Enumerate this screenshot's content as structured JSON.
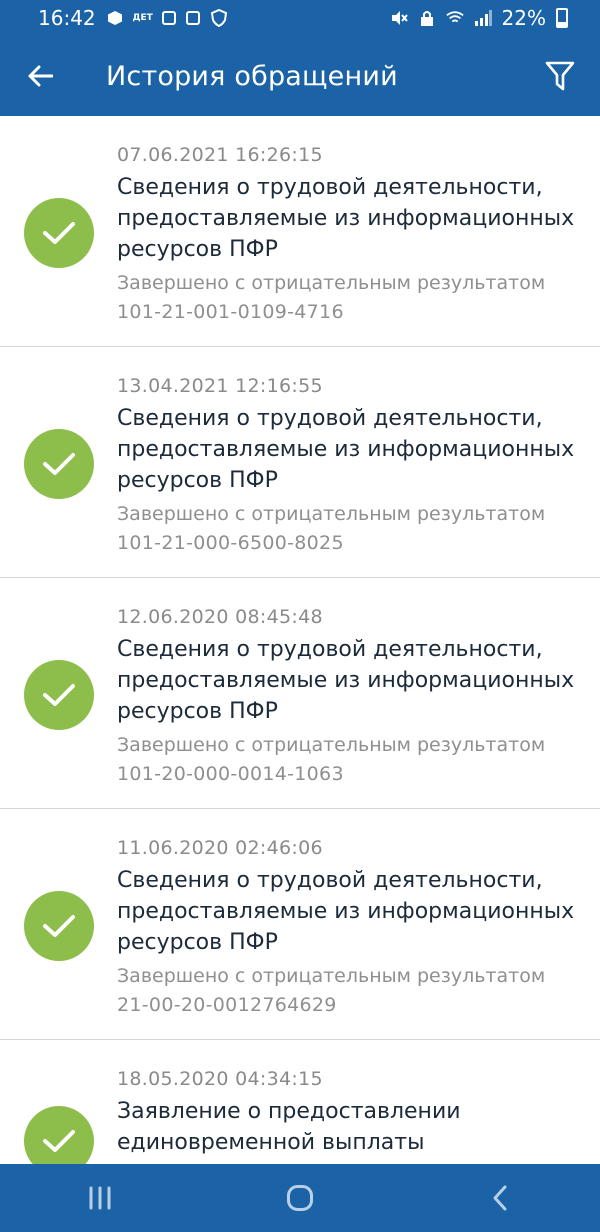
{
  "status_bar": {
    "time": "16:42",
    "battery": "22%",
    "icons": [
      "cube-icon",
      "detmir-icon",
      "qr-icon",
      "camera-icon",
      "shield-icon",
      "mute-icon",
      "lock-icon",
      "wifi-icon",
      "signal-icon",
      "battery-icon"
    ]
  },
  "header": {
    "title": "История обращений",
    "back_icon": "arrow-left-icon",
    "filter_icon": "filter-icon"
  },
  "colors": {
    "primary": "#1b63a6",
    "success": "#8dbd4a"
  },
  "items": [
    {
      "date": "07.06.2021 16:26:15",
      "title": "Сведения о трудовой деятельности, предоставляемые из информационных ресурсов ПФР",
      "status": "Завершено с отрицательным результатом",
      "number": "101-21-001-0109-4716"
    },
    {
      "date": "13.04.2021 12:16:55",
      "title": "Сведения о трудовой деятельности, предоставляемые из информационных ресурсов ПФР",
      "status": "Завершено с отрицательным результатом",
      "number": "101-21-000-6500-8025"
    },
    {
      "date": "12.06.2020 08:45:48",
      "title": "Сведения о трудовой деятельности, предоставляемые из информационных ресурсов ПФР",
      "status": "Завершено с отрицательным результатом",
      "number": "101-20-000-0014-1063"
    },
    {
      "date": "11.06.2020 02:46:06",
      "title": "Сведения о трудовой деятельности, предоставляемые из информационных ресурсов ПФР",
      "status": "Завершено с отрицательным результатом",
      "number": "21-00-20-0012764629"
    },
    {
      "date": "18.05.2020 04:34:15",
      "title": "Заявление о предоставлении единовременной выплаты",
      "status": "",
      "number": ""
    }
  ],
  "nav": {
    "icons": [
      "recent-apps-icon",
      "home-icon",
      "back-icon"
    ]
  }
}
